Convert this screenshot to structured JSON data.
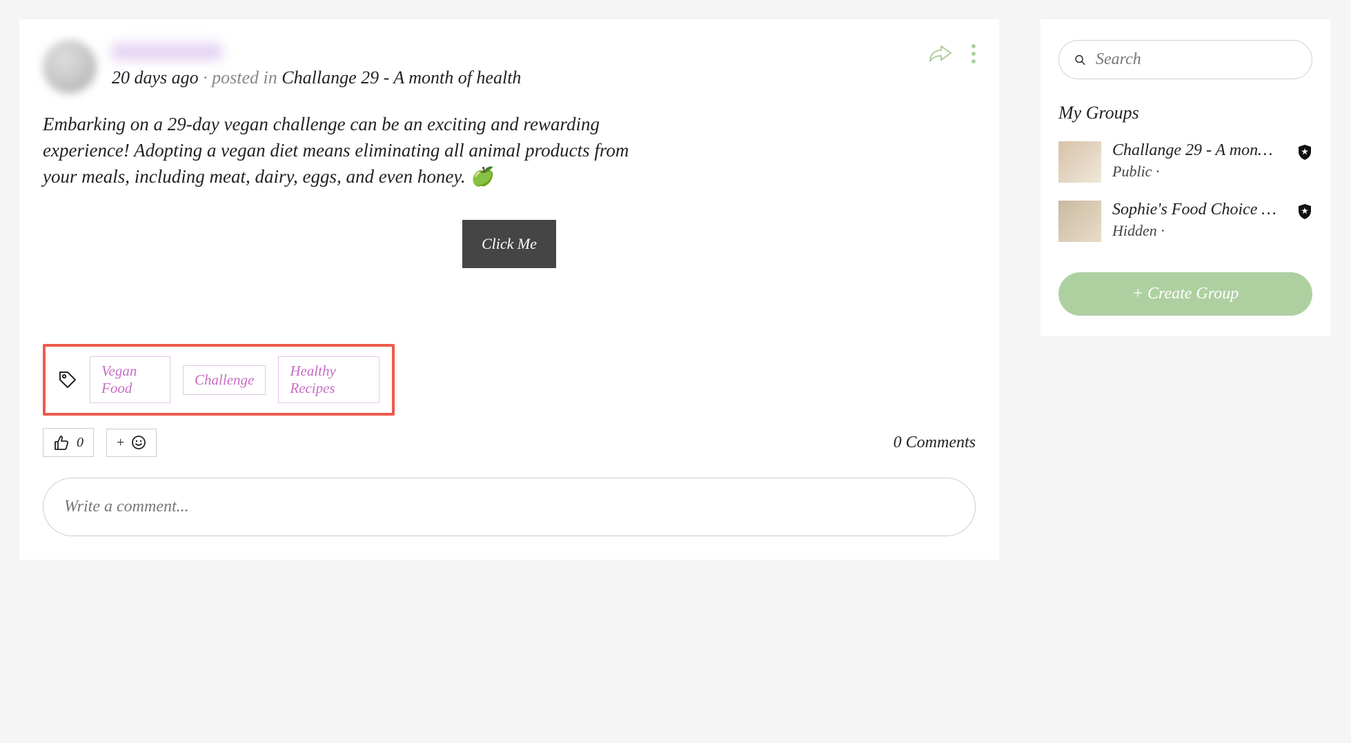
{
  "post": {
    "meta_time": "20 days ago",
    "meta_posted_in_label": "posted in",
    "meta_group_name": "Challange 29 - A month of health",
    "body_text": "Embarking on a 29-day vegan challenge can be an exciting and rewarding experience! Adopting a vegan diet means eliminating all animal products from your meals, including meat, dairy, eggs, and even honey. 🍏",
    "click_button_label": "Click Me",
    "tags": [
      "Vegan Food",
      "Challenge",
      "Healthy Recipes"
    ],
    "like_count": "0",
    "comments_count_label": "0 Comments",
    "comment_placeholder": "Write a comment..."
  },
  "sidebar": {
    "search_placeholder": "Search",
    "my_groups_heading": "My Groups",
    "groups": [
      {
        "name": "Challange 29 - A mon…",
        "visibility": "Public ·"
      },
      {
        "name": "Sophie's Food Choice …",
        "visibility": "Hidden ·"
      }
    ],
    "create_group_label": "+ Create Group"
  }
}
